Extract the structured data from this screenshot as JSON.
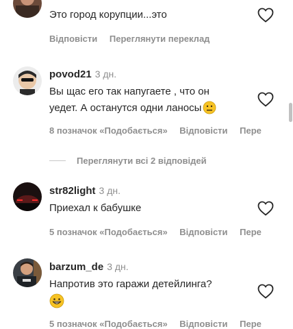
{
  "comments": [
    {
      "username": "",
      "time": "",
      "text": "Это город корупции...это",
      "actions": [
        "Відповісти",
        "Переглянути переклад"
      ]
    },
    {
      "username": "povod21",
      "time": "3 дн.",
      "text_line1": "Вы щас его так напугаете , что он",
      "text_line2": "уедет. А останутся одни ланосы",
      "emoji": "confused-face-emoji",
      "actions": [
        "8 позначок «Подобається»",
        "Відповісти",
        "Пере"
      ]
    },
    {
      "username": "str82light",
      "time": "3 дн.",
      "text": "Приехал к бабушке",
      "actions": [
        "5 позначок «Подобається»",
        "Відповісти",
        "Пере"
      ]
    },
    {
      "username": "barzum_de",
      "time": "3 дн.",
      "text": "Напротив это гаражи детейлинга?",
      "emoji": "grinning-face-emoji",
      "actions": [
        "5 позначок «Подобається»",
        "Відповісти",
        "Пере"
      ]
    }
  ],
  "view_replies": "Переглянути всі 2 відповідей",
  "colors": {
    "primary_text": "#262626",
    "secondary_text": "#8e8e8e",
    "emoji_yellow": "#f7c325"
  },
  "icons": [
    "heart-icon"
  ]
}
